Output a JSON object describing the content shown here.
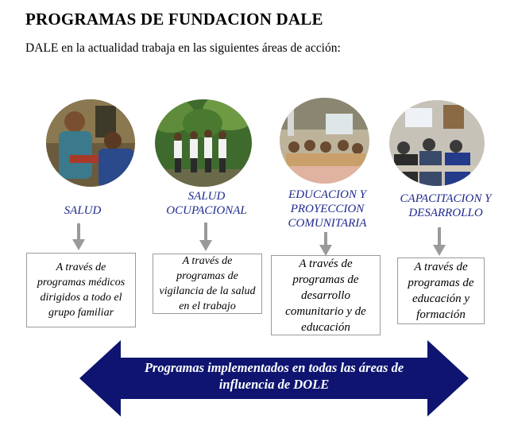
{
  "title": "PROGRAMAS DE FUNDACION DALE",
  "intro": "DALE en la actualidad trabaja en las siguientes áreas de acción:",
  "areas": [
    {
      "name": "SALUD",
      "description": "A través de programas médicos dirigidos a todo el grupo familiar"
    },
    {
      "name": "SALUD OCUPACIONAL",
      "description": "A través de programas de vigilancia de la salud en el trabajo"
    },
    {
      "name": "EDUCACION Y PROYECCION COMUNITARIA",
      "description": "A través de programas de desarrollo comunitario y de educación"
    },
    {
      "name": "CAPACITACION Y DESARROLLO",
      "description": "A través de programas de educación y formación"
    }
  ],
  "banner": "Programas implementados en todas las áreas de influencia de DOLE",
  "colors": {
    "label": "#1f2a8c",
    "banner": "#0e1470",
    "arrow": "#999999"
  }
}
